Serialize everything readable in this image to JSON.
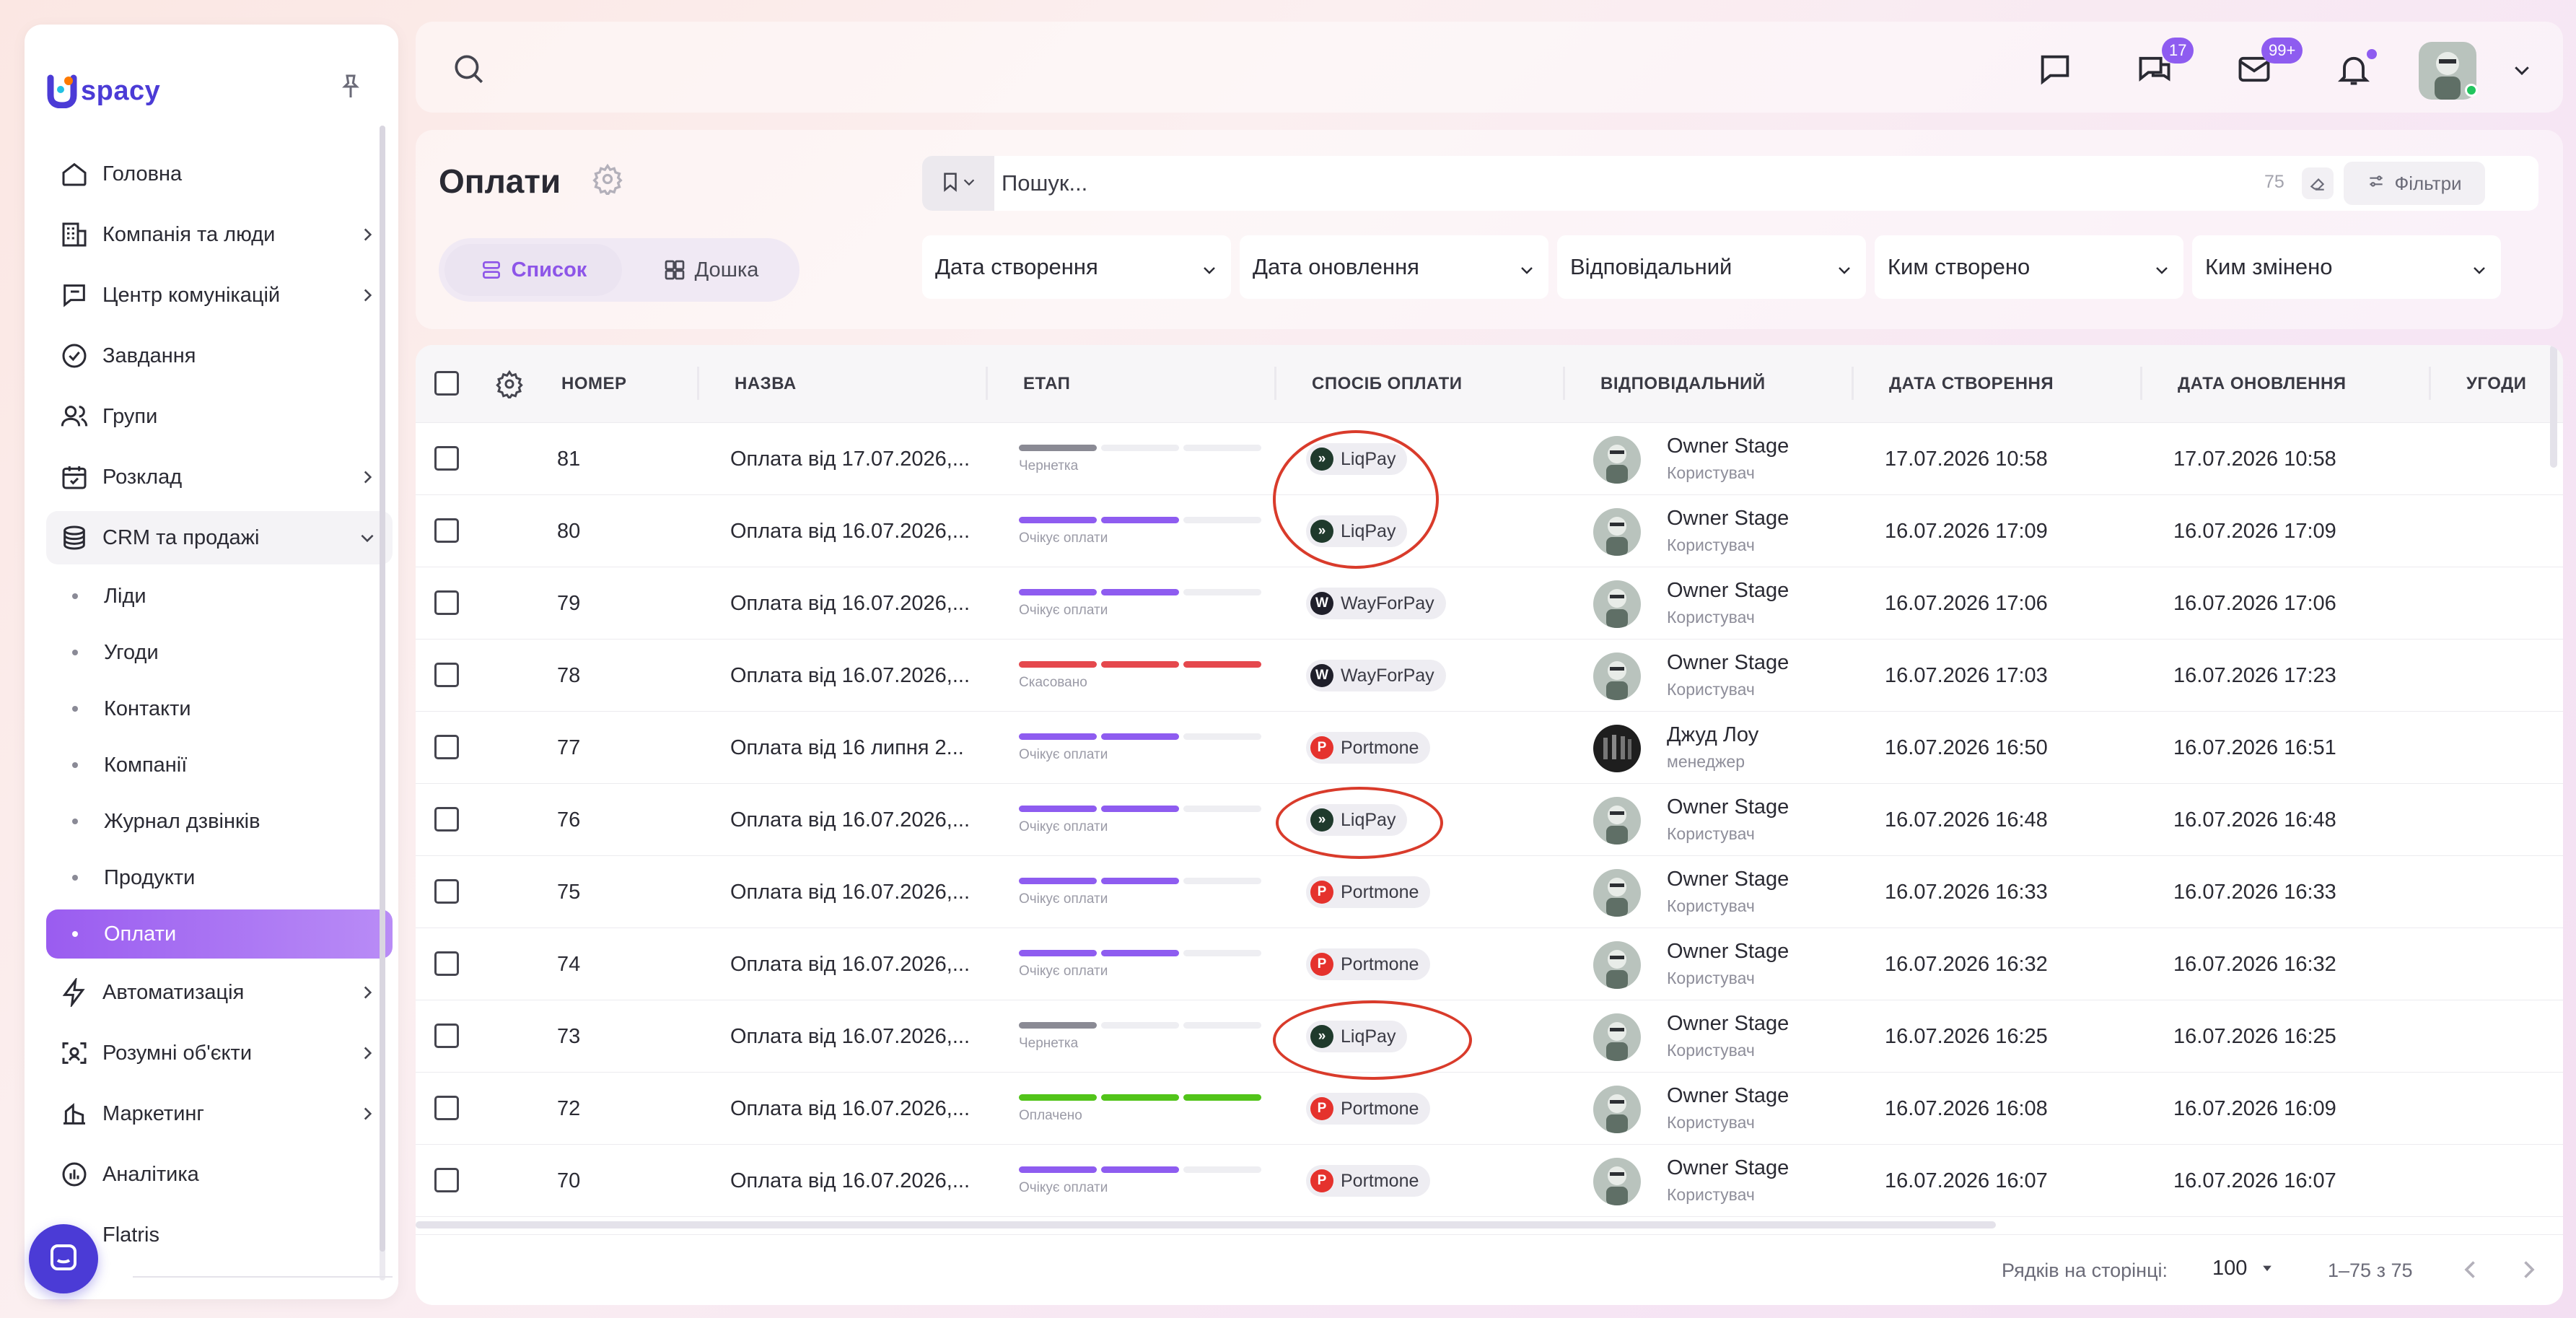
{
  "brand": {
    "logo_text": "spacy",
    "accent": "#8e5cf0",
    "brand_color": "#4b3bd6"
  },
  "sidebar": {
    "items": [
      {
        "label": "Головна",
        "icon": "home-icon",
        "chevron": false
      },
      {
        "label": "Компанія та люди",
        "icon": "company-icon",
        "chevron": true
      },
      {
        "label": "Центр комунікацій",
        "icon": "communication-icon",
        "chevron": true
      },
      {
        "label": "Завдання",
        "icon": "task-check-icon",
        "chevron": false
      },
      {
        "label": "Групи",
        "icon": "groups-icon",
        "chevron": false
      },
      {
        "label": "Розклад",
        "icon": "calendar-icon",
        "chevron": true
      },
      {
        "label": "CRM та продажі",
        "icon": "crm-icon",
        "chevron": "down"
      }
    ],
    "sub_items": [
      {
        "label": "Ліди",
        "active": false
      },
      {
        "label": "Угоди",
        "active": false
      },
      {
        "label": "Контакти",
        "active": false
      },
      {
        "label": "Компанії",
        "active": false
      },
      {
        "label": "Журнал дзвінків",
        "active": false
      },
      {
        "label": "Продукти",
        "active": false
      },
      {
        "label": "Оплати",
        "active": true
      }
    ],
    "items_after": [
      {
        "label": "Автоматизація",
        "icon": "automation-icon",
        "chevron": true
      },
      {
        "label": "Розумні об'єкти",
        "icon": "smart-objects-icon",
        "chevron": true
      },
      {
        "label": "Маркетинг",
        "icon": "marketing-icon",
        "chevron": true
      },
      {
        "label": "Аналітика",
        "icon": "analytics-icon",
        "chevron": false
      },
      {
        "label": "Flatris",
        "icon": "",
        "chevron": false
      }
    ]
  },
  "topbar": {
    "chat_badge": "17",
    "mail_badge": "99+"
  },
  "header": {
    "title": "Оплати",
    "view_list": "Список",
    "view_board": "Дошка",
    "search_placeholder": "Пошук...",
    "search_count": "75",
    "filters_label": "Фільтри",
    "filter_selects": [
      "Дата створення",
      "Дата оновлення",
      "Відповідальний",
      "Ким створено",
      "Ким змінено"
    ]
  },
  "table": {
    "columns": [
      "НОМЕР",
      "НАЗВА",
      "ЕТАП",
      "СПОСІБ ОПЛАТИ",
      "ВІДПОВІДАЛЬНИЙ",
      "ДАТА СТВОРЕННЯ",
      "ДАТА ОНОВЛЕННЯ",
      "УГОДИ"
    ],
    "stage_colors": {
      "Чернетка": "#8a8a94",
      "Очікує оплати": "#8e5cf0",
      "Скасовано": "#e5484d",
      "Оплачено": "#52c41a"
    },
    "rows": [
      {
        "number": "81",
        "name": "Оплата від 17.07.2026,...",
        "stage": "Чернетка",
        "stage_filled": 1,
        "method": "LiqPay",
        "owner": "Owner Stage",
        "role": "Користувач",
        "created": "17.07.2026 10:58",
        "updated": "17.07.2026 10:58"
      },
      {
        "number": "80",
        "name": "Оплата від 16.07.2026,...",
        "stage": "Очікує оплати",
        "stage_filled": 2,
        "method": "LiqPay",
        "owner": "Owner Stage",
        "role": "Користувач",
        "created": "16.07.2026 17:09",
        "updated": "16.07.2026 17:09"
      },
      {
        "number": "79",
        "name": "Оплата від 16.07.2026,...",
        "stage": "Очікує оплати",
        "stage_filled": 2,
        "method": "WayForPay",
        "owner": "Owner Stage",
        "role": "Користувач",
        "created": "16.07.2026 17:06",
        "updated": "16.07.2026 17:06"
      },
      {
        "number": "78",
        "name": "Оплата від 16.07.2026,...",
        "stage": "Скасовано",
        "stage_filled": 3,
        "method": "WayForPay",
        "owner": "Owner Stage",
        "role": "Користувач",
        "created": "16.07.2026 17:03",
        "updated": "16.07.2026 17:23"
      },
      {
        "number": "77",
        "name": "Оплата від 16 липня 2...",
        "stage": "Очікує оплати",
        "stage_filled": 2,
        "method": "Portmone",
        "owner": "Джуд Лоу",
        "role": "менеджер",
        "created": "16.07.2026 16:50",
        "updated": "16.07.2026 16:51"
      },
      {
        "number": "76",
        "name": "Оплата від 16.07.2026,...",
        "stage": "Очікує оплати",
        "stage_filled": 2,
        "method": "LiqPay",
        "owner": "Owner Stage",
        "role": "Користувач",
        "created": "16.07.2026 16:48",
        "updated": "16.07.2026 16:48"
      },
      {
        "number": "75",
        "name": "Оплата від 16.07.2026,...",
        "stage": "Очікує оплати",
        "stage_filled": 2,
        "method": "Portmone",
        "owner": "Owner Stage",
        "role": "Користувач",
        "created": "16.07.2026 16:33",
        "updated": "16.07.2026 16:33"
      },
      {
        "number": "74",
        "name": "Оплата від 16.07.2026,...",
        "stage": "Очікує оплати",
        "stage_filled": 2,
        "method": "Portmone",
        "owner": "Owner Stage",
        "role": "Користувач",
        "created": "16.07.2026 16:32",
        "updated": "16.07.2026 16:32"
      },
      {
        "number": "73",
        "name": "Оплата від 16.07.2026,...",
        "stage": "Чернетка",
        "stage_filled": 1,
        "method": "LiqPay",
        "owner": "Owner Stage",
        "role": "Користувач",
        "created": "16.07.2026 16:25",
        "updated": "16.07.2026 16:25"
      },
      {
        "number": "72",
        "name": "Оплата від 16.07.2026,...",
        "stage": "Оплачено",
        "stage_filled": 3,
        "method": "Portmone",
        "owner": "Owner Stage",
        "role": "Користувач",
        "created": "16.07.2026 16:08",
        "updated": "16.07.2026 16:09"
      },
      {
        "number": "70",
        "name": "Оплата від 16.07.2026,...",
        "stage": "Очікує оплати",
        "stage_filled": 2,
        "method": "Portmone",
        "owner": "Owner Stage",
        "role": "Користувач",
        "created": "16.07.2026 16:07",
        "updated": "16.07.2026 16:07"
      }
    ]
  },
  "pagination": {
    "rows_label": "Рядків на сторінці:",
    "rows_value": "100",
    "range": "1–75 з 75"
  }
}
